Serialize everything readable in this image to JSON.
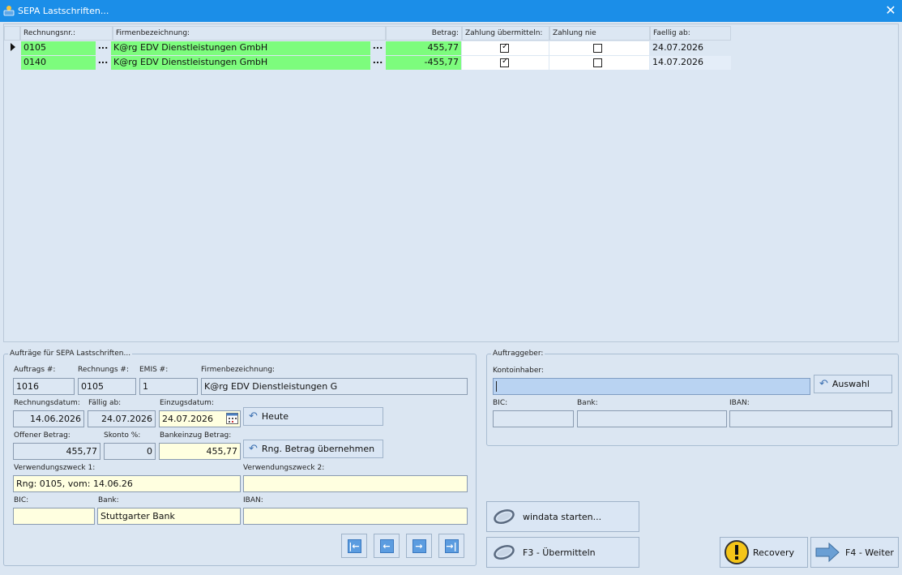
{
  "window": {
    "title": "SEPA Lastschriften...",
    "close_icon": "close-icon",
    "app_icon": "sepa-app-icon"
  },
  "grid": {
    "headers": {
      "rechnungsnr": "Rechnungsnr.:",
      "firma": "Firmenbezeichnung:",
      "betrag": "Betrag:",
      "zahlung": "Zahlung übermitteln:",
      "nie": "Zahlung nie",
      "faellig": "Faellig ab:"
    },
    "rows": [
      {
        "rechnungsnr": "0105",
        "firma": "K@rg EDV Dienstleistungen GmbH",
        "betrag": "455,77",
        "uebermitteln": true,
        "nie": false,
        "faellig": "24.07.2026",
        "dots": "..."
      },
      {
        "rechnungsnr": "0140",
        "firma": "K@rg EDV Dienstleistungen GmbH",
        "betrag": "-455,77",
        "uebermitteln": true,
        "nie": false,
        "faellig": "14.07.2026",
        "dots": "..."
      }
    ]
  },
  "auftraege": {
    "group_title": "Aufträge für SEPA Lastschriften...",
    "labels": {
      "auftrags_nr": "Auftrags #:",
      "rechnungs_nr": "Rechnungs #:",
      "emis_nr": "EMIS #:",
      "firma": "Firmenbezeichnung:",
      "rechnungsdatum": "Rechnungsdatum:",
      "faellig_ab": "Fällig ab:",
      "einzugsdatum": "Einzugsdatum:",
      "offener_betrag": "Offener Betrag:",
      "skonto": "Skonto %:",
      "bankeinzug": "Bankeinzug Betrag:",
      "vz1": "Verwendungszweck 1:",
      "vz2": "Verwendungszweck 2:",
      "bic": "BIC:",
      "bank": "Bank:",
      "iban": "IBAN:"
    },
    "values": {
      "auftrags_nr": "1016",
      "rechnungs_nr": "0105",
      "emis_nr": "1",
      "firma": "K@rg EDV Dienstleistungen G",
      "rechnungsdatum": "14.06.2026",
      "faellig_ab": "24.07.2026",
      "einzugsdatum": "24.07.2026",
      "offener_betrag": "455,77",
      "skonto": "0",
      "bankeinzug": "455,77",
      "vz1": "Rng: 0105, vom: 14.06.26",
      "vz2": "",
      "bic": "",
      "bank": "Stuttgarter Bank",
      "iban": ""
    },
    "buttons": {
      "heute": "Heute",
      "rng_betrag": "Rng. Betrag übernehmen"
    }
  },
  "auftraggeber": {
    "group_title": "Auftraggeber:",
    "labels": {
      "kontoinhaber": "Kontoinhaber:",
      "bic": "BIC:",
      "bank": "Bank:",
      "iban": "IBAN:"
    },
    "values": {
      "kontoinhaber": "",
      "bic": "",
      "bank": "",
      "iban": ""
    },
    "buttons": {
      "auswahl": "Auswahl"
    }
  },
  "actions": {
    "windata": "windata starten...",
    "uebermitteln": "F3 - Übermitteln",
    "recovery": "Recovery",
    "weiter": "F4 - Weiter"
  },
  "colors": {
    "titlebar": "#1b8ee8",
    "row_highlight": "#7dfc7d",
    "background": "#dbe6f2",
    "input_yellow": "#ffffe0"
  }
}
